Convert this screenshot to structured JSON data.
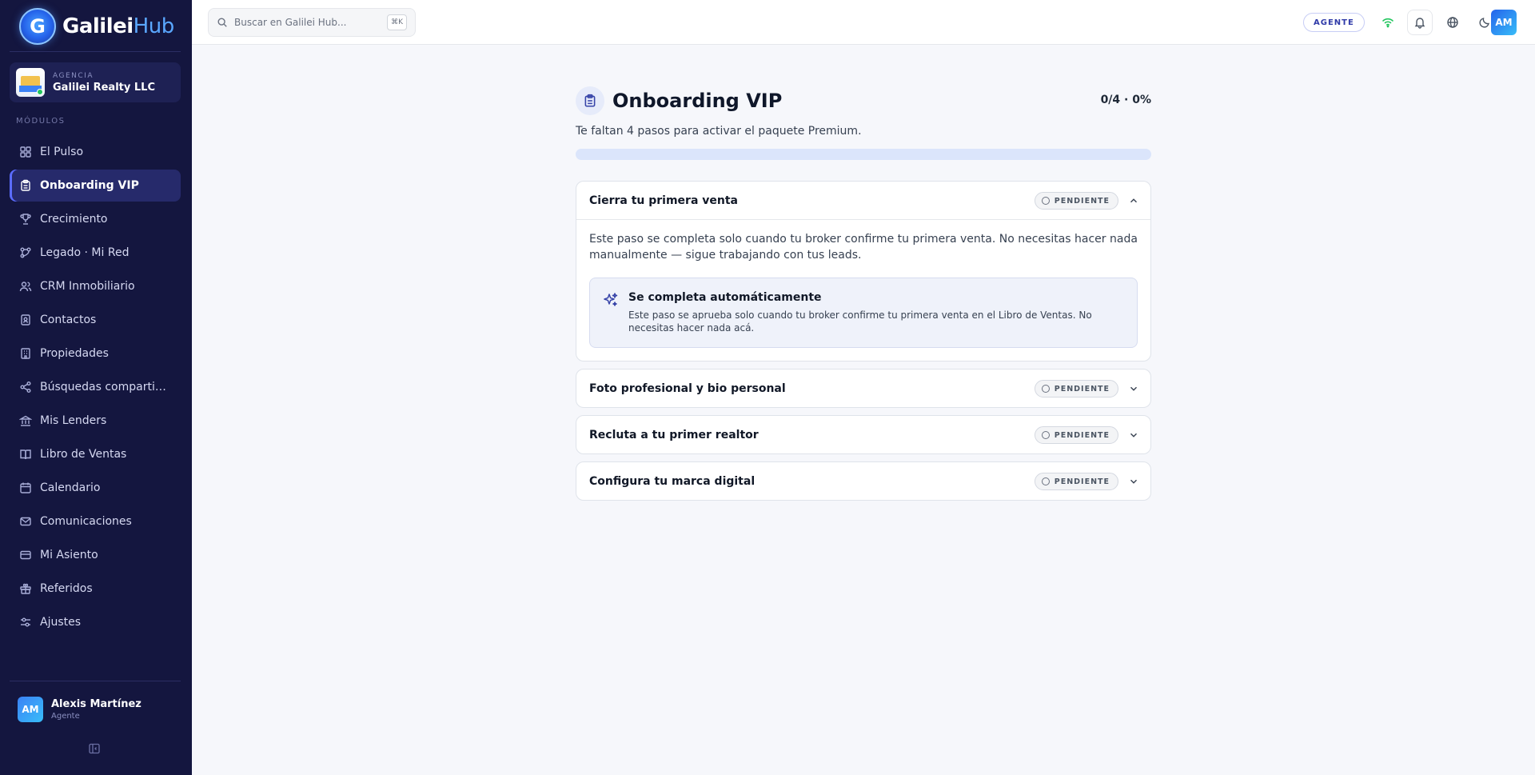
{
  "brand": {
    "name": "Galilei",
    "suffix": "Hub",
    "mark": "G"
  },
  "agency": {
    "label": "AGENCIA",
    "name": "Galilei Realty LLC"
  },
  "sidebar": {
    "section_label": "MÓDULOS",
    "items": [
      {
        "label": "El Pulso",
        "icon": "dashboard-icon"
      },
      {
        "label": "Onboarding VIP",
        "icon": "clipboard-icon",
        "active": true
      },
      {
        "label": "Crecimiento",
        "icon": "trophy-icon"
      },
      {
        "label": "Legado · Mi Red",
        "icon": "network-icon"
      },
      {
        "label": "CRM Inmobiliario",
        "icon": "users-icon"
      },
      {
        "label": "Contactos",
        "icon": "contacts-icon"
      },
      {
        "label": "Propiedades",
        "icon": "building-icon"
      },
      {
        "label": "Búsquedas compartid...",
        "icon": "share-icon"
      },
      {
        "label": "Mis Lenders",
        "icon": "bank-icon"
      },
      {
        "label": "Libro de Ventas",
        "icon": "book-icon"
      },
      {
        "label": "Calendario",
        "icon": "calendar-icon"
      },
      {
        "label": "Comunicaciones",
        "icon": "mail-icon"
      },
      {
        "label": "Mi Asiento",
        "icon": "card-icon"
      },
      {
        "label": "Referidos",
        "icon": "gift-icon"
      },
      {
        "label": "Ajustes",
        "icon": "settings-icon"
      }
    ]
  },
  "user": {
    "initials": "AM",
    "name": "Alexis Martínez",
    "role": "Agente"
  },
  "topbar": {
    "search_placeholder": "Buscar en Galilei Hub...",
    "search_shortcut": "⌘K",
    "role_badge": "AGENTE",
    "avatar_initials": "AM"
  },
  "main": {
    "title": "Onboarding VIP",
    "progress_text": "0/4 · 0%",
    "progress_fraction": 0,
    "subtitle": "Te faltan 4 pasos para activar el paquete Premium.",
    "steps": [
      {
        "title": "Cierra tu primera venta",
        "status": "PENDIENTE",
        "expanded": true,
        "description": "Este paso se completa solo cuando tu broker confirme tu primera venta. No necesitas hacer nada manualmente — sigue trabajando con tus leads.",
        "auto_title": "Se completa automáticamente",
        "auto_text": "Este paso se aprueba solo cuando tu broker confirme tu primera venta en el Libro de Ventas. No necesitas hacer nada acá."
      },
      {
        "title": "Foto profesional y bio personal",
        "status": "PENDIENTE",
        "expanded": false
      },
      {
        "title": "Recluta a tu primer realtor",
        "status": "PENDIENTE",
        "expanded": false
      },
      {
        "title": "Configura tu marca digital",
        "status": "PENDIENTE",
        "expanded": false
      }
    ]
  },
  "colors": {
    "sidebar_bg": "#14163f",
    "accent": "#3b5bdb",
    "brand_blue": "#5aa7ff",
    "progress_track": "#dbe5fb"
  }
}
